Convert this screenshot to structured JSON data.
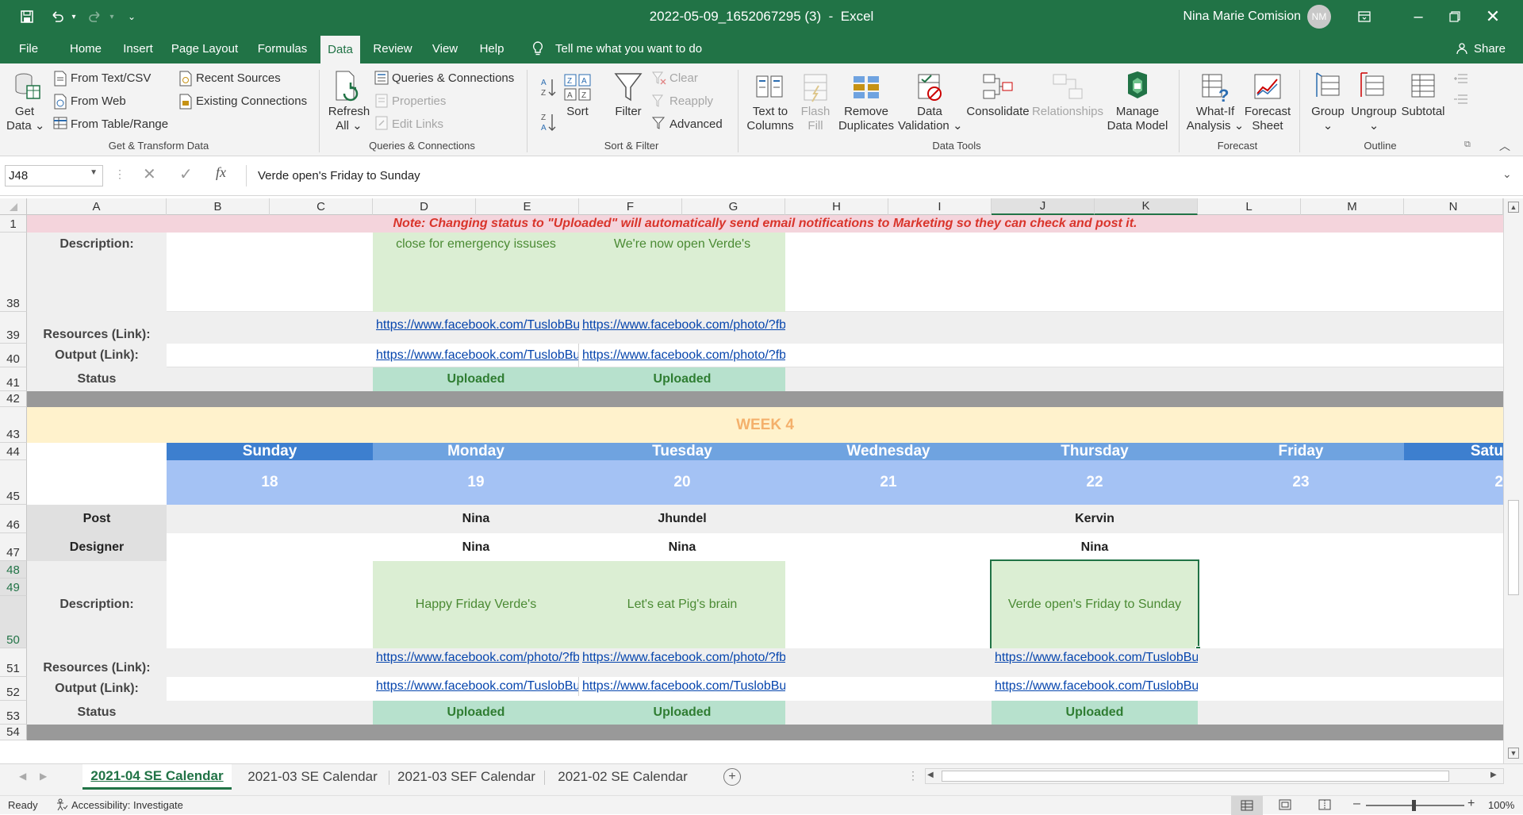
{
  "titlebar": {
    "filename": "2022-05-09_1652067295 (3)",
    "sep": "-",
    "app": "Excel",
    "user": "Nina Marie Comision",
    "initials": "NM"
  },
  "menu": {
    "tabs": [
      "File",
      "Home",
      "Insert",
      "Page Layout",
      "Formulas",
      "Data",
      "Review",
      "View",
      "Help"
    ],
    "tell_me": "Tell me what you want to do",
    "share": "Share"
  },
  "ribbon": {
    "get_data_1": "Get",
    "get_data_2": "Data",
    "from_text": "From Text/CSV",
    "from_web": "From Web",
    "from_table": "From Table/Range",
    "recent_sources": "Recent Sources",
    "existing_connections": "Existing Connections",
    "grp_get": "Get & Transform Data",
    "refresh_1": "Refresh",
    "refresh_2": "All",
    "queries_conn": "Queries & Connections",
    "properties": "Properties",
    "edit_links": "Edit Links",
    "grp_queries": "Queries & Connections",
    "sort": "Sort",
    "filter": "Filter",
    "clear": "Clear",
    "reapply": "Reapply",
    "advanced": "Advanced",
    "grp_sort": "Sort & Filter",
    "text_cols_1": "Text to",
    "text_cols_2": "Columns",
    "flash_1": "Flash",
    "flash_2": "Fill",
    "remove_dup_1": "Remove",
    "remove_dup_2": "Duplicates",
    "data_val_1": "Data",
    "data_val_2": "Validation",
    "consolidate": "Consolidate",
    "relationships": "Relationships",
    "manage_1": "Manage",
    "manage_2": "Data Model",
    "grp_tools": "Data Tools",
    "whatif_1": "What-If",
    "whatif_2": "Analysis",
    "forecast_1": "Forecast",
    "forecast_2": "Sheet",
    "grp_forecast": "Forecast",
    "group": "Group",
    "ungroup": "Ungroup",
    "subtotal": "Subtotal",
    "grp_outline": "Outline"
  },
  "formula": {
    "namebox": "J48",
    "fx": "fx",
    "content": "Verde open's Friday to Sunday"
  },
  "columns": [
    "A",
    "B",
    "C",
    "D",
    "E",
    "F",
    "G",
    "H",
    "I",
    "J",
    "K",
    "L",
    "M",
    "N"
  ],
  "rows": {
    "r1": "1",
    "r38": "38",
    "r39": "39",
    "r40": "40",
    "r41": "41",
    "r42": "42",
    "r43": "43",
    "r44": "44",
    "r45": "45",
    "r46": "46",
    "r47": "47",
    "r48": "48",
    "r49": "49",
    "r50": "50",
    "r51": "51",
    "r52": "52",
    "r53": "53",
    "r54": "54"
  },
  "sheet": {
    "note": "Note: Changing status to \"Uploaded\" will automatically send email notifications to Marketing so they can check and post it.",
    "labels": {
      "description": "Description:",
      "resources": "Resources (Link):",
      "output": "Output (Link):",
      "status": "Status",
      "post": "Post",
      "designer": "Designer"
    },
    "week3": {
      "desc_d": "close for emergency issuses",
      "desc_f": "We're now open Verde's",
      "res_d": "https://www.facebook.com/TuslobBu",
      "res_f": "https://www.facebook.com/photo/?fb",
      "out_d": "https://www.facebook.com/TuslobBu",
      "out_f": "https://www.facebook.com/photo/?fb",
      "status_d": "Uploaded",
      "status_f": "Uploaded"
    },
    "week4": {
      "title": "WEEK 4",
      "days": [
        "Sunday",
        "Monday",
        "Tuesday",
        "Wednesday",
        "Thursday",
        "Friday",
        "Satu"
      ],
      "dates": [
        "18",
        "19",
        "20",
        "21",
        "22",
        "23",
        "2"
      ],
      "post_mon": "Nina",
      "post_tue": "Jhundel",
      "post_thu": "Kervin",
      "des_mon": "Nina",
      "des_tue": "Nina",
      "des_thu": "Nina",
      "desc_mon": "Happy Friday Verde's",
      "desc_tue": "Let's eat Pig's brain",
      "desc_thu": "Verde open's Friday to Sunday",
      "res_mon": "https://www.facebook.com/photo/?fb",
      "res_tue": "https://www.facebook.com/photo/?fb",
      "res_thu": "https://www.facebook.com/TuslobBu",
      "out_mon": "https://www.facebook.com/TuslobBu",
      "out_tue": "https://www.facebook.com/TuslobBu",
      "out_thu": "https://www.facebook.com/TuslobBu",
      "status_mon": "Uploaded",
      "status_tue": "Uploaded",
      "status_thu": "Uploaded"
    }
  },
  "sheettabs": [
    "2021-04 SE Calendar",
    "2021-03 SE Calendar",
    "2021-03 SEF Calendar",
    "2021-02 SE Calendar"
  ],
  "status": {
    "ready": "Ready",
    "accessibility": "Accessibility: Investigate",
    "zoom": "100%"
  },
  "colors": {
    "brand": "#217346",
    "note_bg": "#f4d4dc",
    "note_text": "#d9342b",
    "week_bg": "#fff2cc",
    "week_text": "#f4b06b",
    "day_dark": "#3d7fcf",
    "day_light": "#6fa3e0",
    "date_bg": "#a4c2f4",
    "desc_green": "#dbeed3",
    "uploaded": "#b7e1cd"
  }
}
